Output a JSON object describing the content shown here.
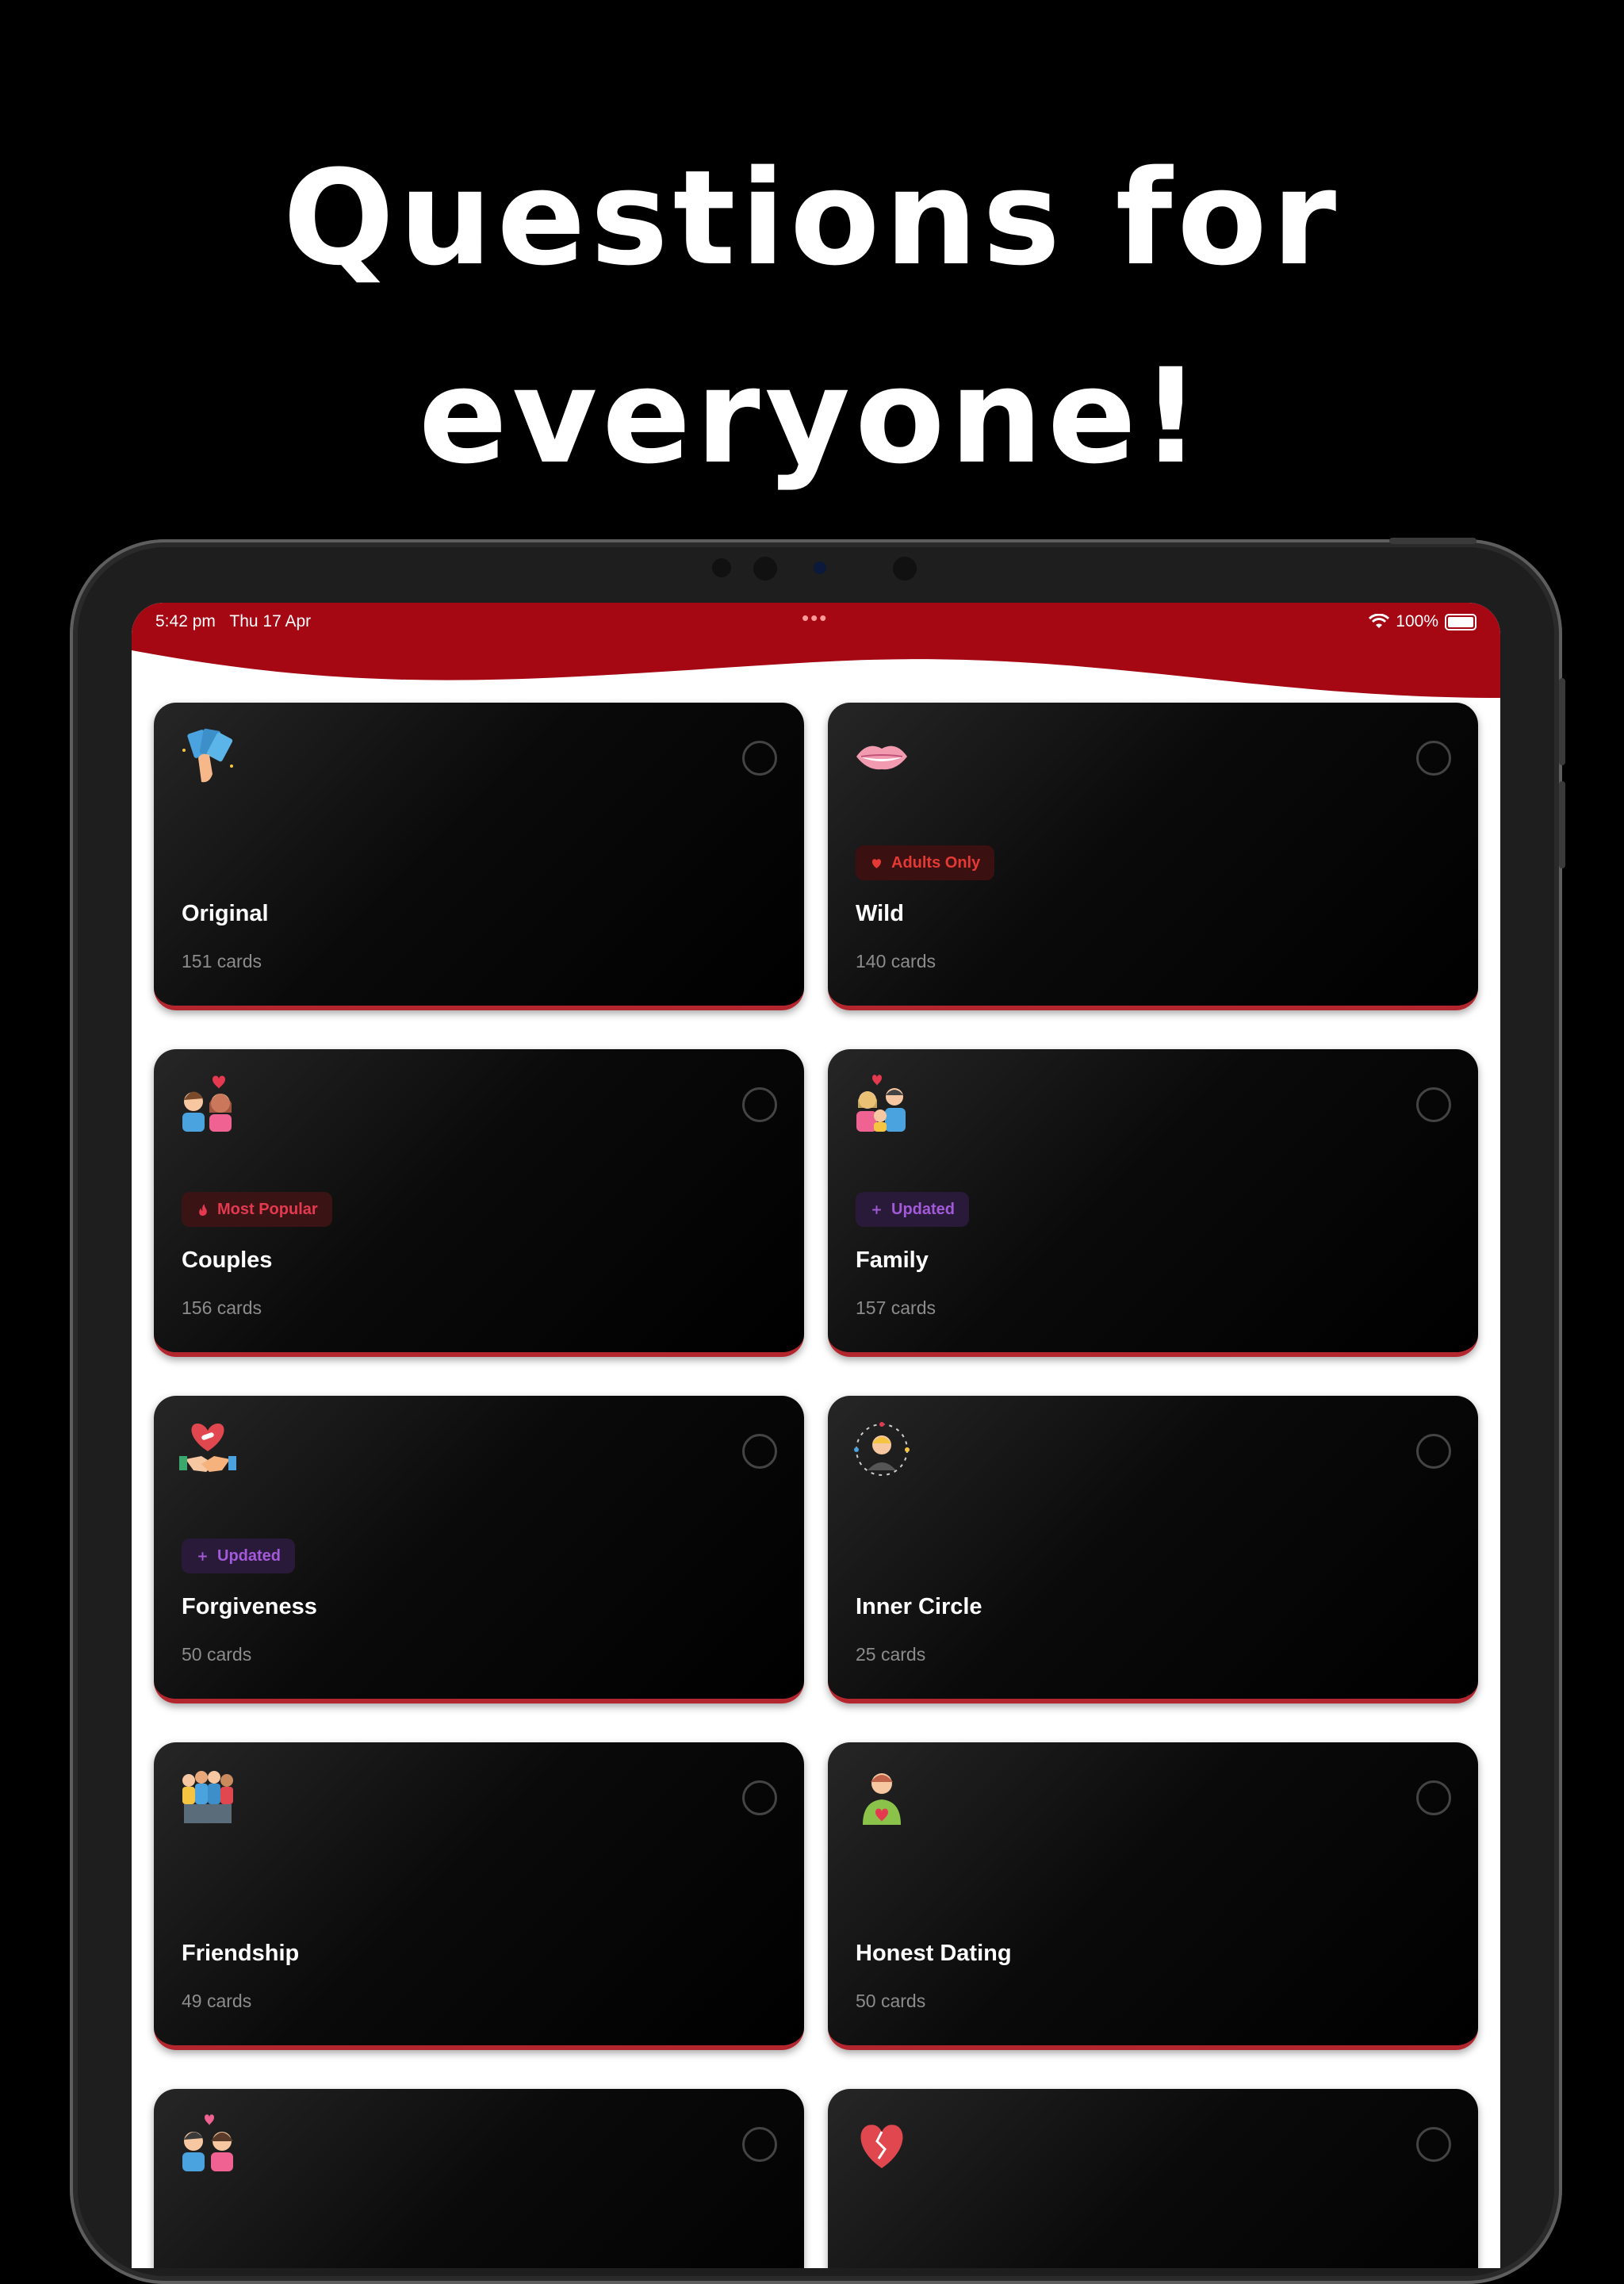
{
  "headline": {
    "line1": "Questions for",
    "line2": "everyone!"
  },
  "status_bar": {
    "time": "5:42 pm",
    "date": "Thu 17 Apr",
    "dots": "•••",
    "battery": "100%"
  },
  "colors": {
    "header": "#a50713",
    "card_accent": "#b3262d",
    "badge_updated": "#a35ad8"
  },
  "decks": [
    {
      "icon": "cards-hand-icon",
      "title": "Original",
      "count": "151 cards",
      "badge": null
    },
    {
      "icon": "lips-icon",
      "title": "Wild",
      "count": "140 cards",
      "badge": "Adults Only",
      "badge_type": "adult",
      "badge_icon": "heart-icon"
    },
    {
      "icon": "couple-heart-icon",
      "title": "Couples",
      "count": "156 cards",
      "badge": "Most Popular",
      "badge_type": "popular",
      "badge_icon": "flame-icon"
    },
    {
      "icon": "family-icon",
      "title": "Family",
      "count": "157 cards",
      "badge": "Updated",
      "badge_type": "updated",
      "badge_icon": "plus-icon"
    },
    {
      "icon": "heart-handshake-icon",
      "title": "Forgiveness",
      "count": "50 cards",
      "badge": "Updated",
      "badge_type": "updated",
      "badge_icon": "plus-icon"
    },
    {
      "icon": "person-circle-icon",
      "title": "Inner Circle",
      "count": "25 cards",
      "badge": null
    },
    {
      "icon": "friends-group-icon",
      "title": "Friendship",
      "count": "49 cards",
      "badge": null
    },
    {
      "icon": "person-heart-icon",
      "title": "Honest Dating",
      "count": "50 cards",
      "badge": null
    },
    {
      "icon": "couple-icon",
      "title": "",
      "count": "",
      "badge": null
    },
    {
      "icon": "broken-heart-icon",
      "title": "",
      "count": "",
      "badge": null
    }
  ]
}
